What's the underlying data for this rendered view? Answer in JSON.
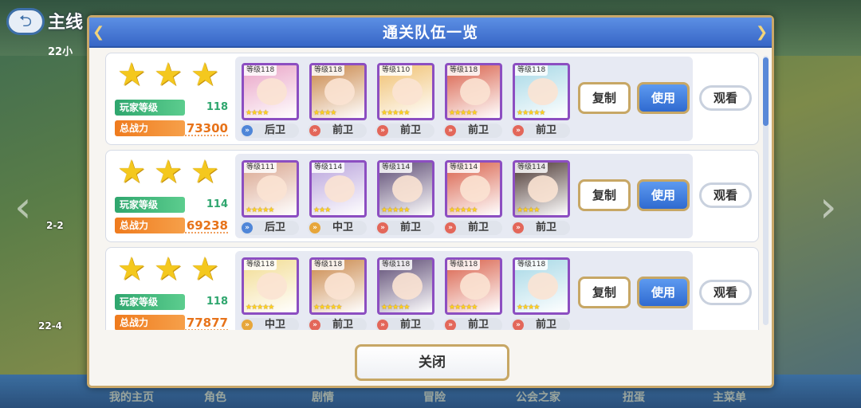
{
  "background": {
    "title": "主线",
    "subtitle": "22小",
    "map_labels": [
      "2-2",
      "22-4"
    ],
    "nav": [
      "我的主页",
      "角色",
      "剧情",
      "冒险",
      "公会之家",
      "扭蛋",
      "主菜单"
    ]
  },
  "dialog": {
    "title": "通关队伍一览",
    "close_label": "关闭",
    "labels": {
      "player_level": "玩家等级",
      "power": "总战力",
      "copy": "复制",
      "use": "使用",
      "view": "观看"
    },
    "teams": [
      {
        "player_level": "118",
        "power": "73300",
        "stars": 3,
        "characters": [
          {
            "level": "等级118",
            "stars": "★★★★",
            "role": "后卫",
            "role_icon": "b",
            "color": "#e9a3c6"
          },
          {
            "level": "等级118",
            "stars": "★★★★",
            "role": "前卫",
            "role_icon": "r",
            "color": "#c98648"
          },
          {
            "level": "等级110",
            "stars": "★★★★★",
            "role": "前卫",
            "role_icon": "r",
            "color": "#f0c070"
          },
          {
            "level": "等级118",
            "stars": "★★★★★",
            "role": "前卫",
            "role_icon": "r",
            "color": "#d9604a"
          },
          {
            "level": "等级118",
            "stars": "★★★★★",
            "role": "前卫",
            "role_icon": "r",
            "color": "#a6d8e6"
          }
        ]
      },
      {
        "player_level": "114",
        "power": "69238",
        "stars": 3,
        "characters": [
          {
            "level": "等级111",
            "stars": "★★★★★",
            "role": "后卫",
            "role_icon": "b",
            "color": "#d9a58e"
          },
          {
            "level": "等级114",
            "stars": "★★★",
            "role": "中卫",
            "role_icon": "y",
            "color": "#b9a3dc"
          },
          {
            "level": "等级114",
            "stars": "★★★★★",
            "role": "前卫",
            "role_icon": "r",
            "color": "#5c4a73"
          },
          {
            "level": "等级114",
            "stars": "★★★★★",
            "role": "前卫",
            "role_icon": "r",
            "color": "#d9604a"
          },
          {
            "level": "等级114",
            "stars": "★★★★",
            "role": "前卫",
            "role_icon": "r",
            "color": "#4a3530"
          }
        ]
      },
      {
        "player_level": "118",
        "power": "77877",
        "stars": 3,
        "characters": [
          {
            "level": "等级118",
            "stars": "★★★★★",
            "role": "中卫",
            "role_icon": "y",
            "color": "#f2dc92"
          },
          {
            "level": "等级118",
            "stars": "★★★★★",
            "role": "前卫",
            "role_icon": "r",
            "color": "#c98648"
          },
          {
            "level": "等级118",
            "stars": "★★★★★",
            "role": "前卫",
            "role_icon": "r",
            "color": "#5c4a73"
          },
          {
            "level": "等级118",
            "stars": "★★★★★",
            "role": "前卫",
            "role_icon": "r",
            "color": "#d9604a"
          },
          {
            "level": "等级118",
            "stars": "★★★★",
            "role": "前卫",
            "role_icon": "r",
            "color": "#a6d8e6"
          }
        ]
      }
    ]
  }
}
